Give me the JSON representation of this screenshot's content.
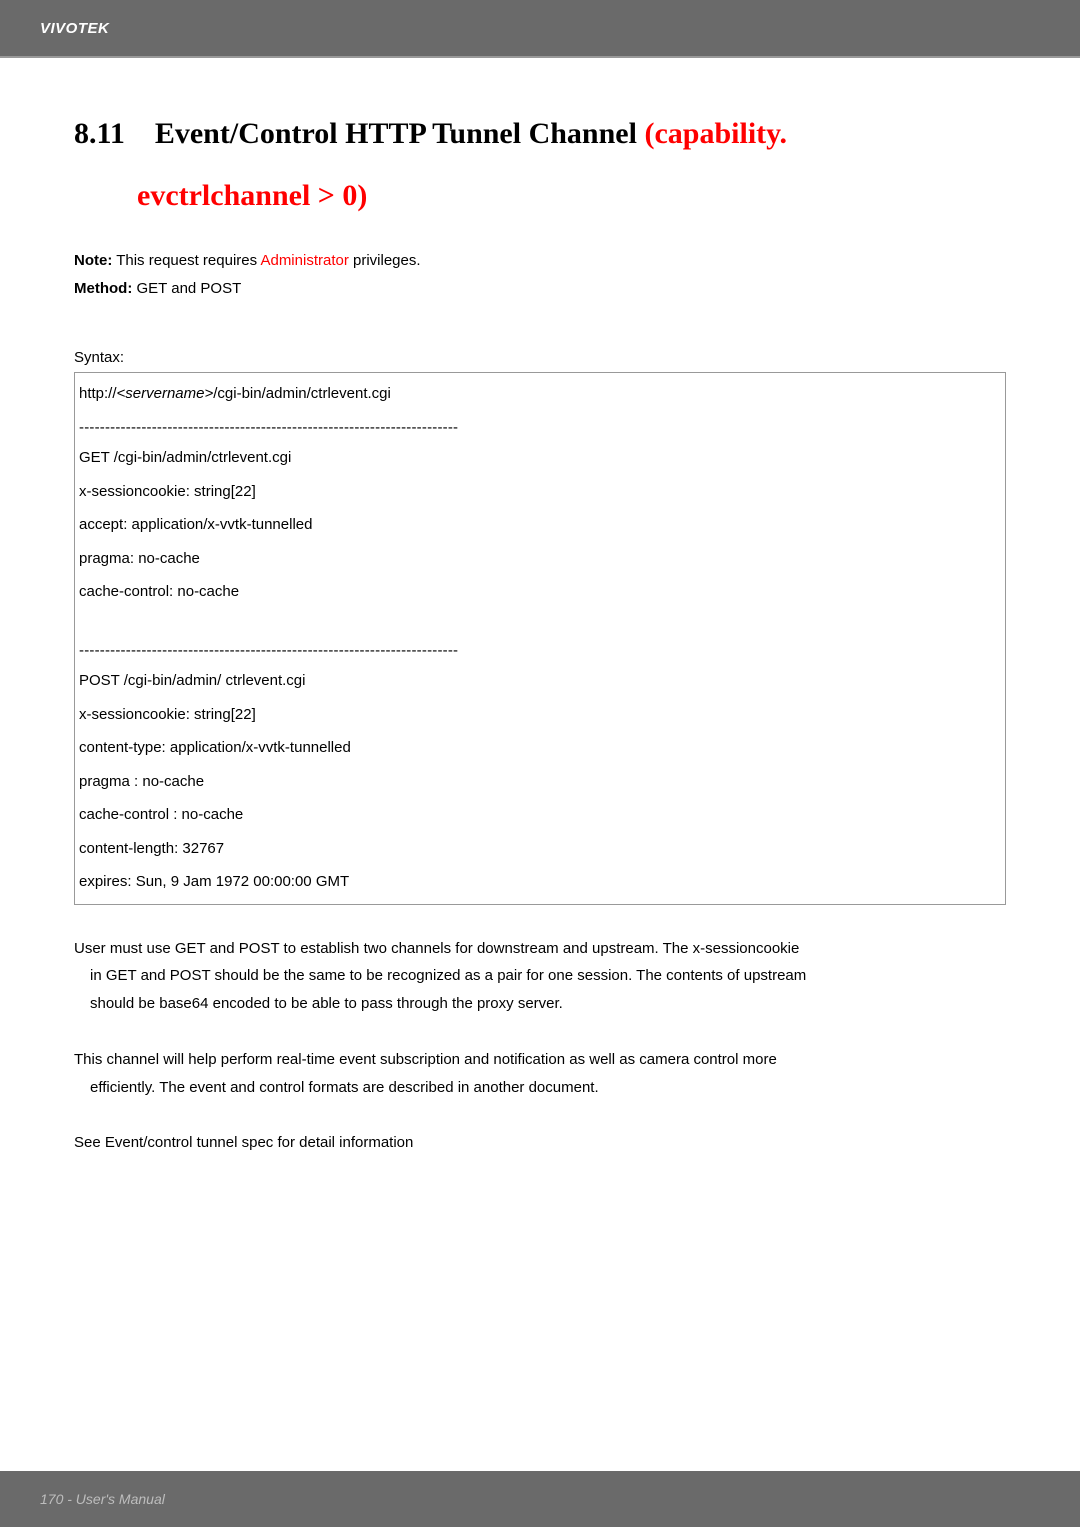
{
  "header": {
    "brand": "VIVOTEK"
  },
  "title": {
    "number": "8.11",
    "main_black": "Event/Control HTTP Tunnel Channel ",
    "main_red": "(capability.",
    "indent_red": "evctrlchannel > 0)"
  },
  "note": {
    "label": "Note:",
    "text_before": " This request requires ",
    "admin": "Administrator",
    "text_after": " privileges."
  },
  "method": {
    "label": "Method:",
    "value": " GET and POST"
  },
  "syntax_label": "Syntax:",
  "syntax": {
    "url_prefix": "http://",
    "servername": "<servername>",
    "url_suffix": "/cgi-bin/admin/ctrlevent.cgi",
    "dashes1": "-------------------------------------------------------------------------",
    "get": "GET /cgi-bin/admin/ctrlevent.cgi",
    "g1": "x-sessioncookie: string[22]",
    "g2": "accept: application/x-vvtk-tunnelled",
    "g3": "pragma: no-cache",
    "g4": "cache-control: no-cache",
    "dashes2": "-------------------------------------------------------------------------",
    "post": "POST /cgi-bin/admin/ ctrlevent.cgi",
    "p1": "x-sessioncookie: string[22]",
    "p2": "content-type: application/x-vvtk-tunnelled",
    "p3": "pragma : no-cache",
    "p4": "cache-control : no-cache",
    "p5": "content-length: 32767",
    "p6": "expires: Sun, 9 Jam 1972 00:00:00 GMT"
  },
  "paragraphs": {
    "p1a": "User must use GET and POST to establish two channels for downstream and upstream. The x-sessioncookie",
    "p1b": "in GET and POST should be the same to be recognized as a pair for one session. The contents of upstream",
    "p1c": "should be base64 encoded to be able to pass through the proxy server.",
    "p2a": "This channel will help perform real-time event subscription and notification as well as camera control more",
    "p2b": "efficiently. The event and control formats are described in another document.",
    "p3": "See Event/control tunnel spec for detail information"
  },
  "footer": {
    "text": "170 - User's Manual"
  }
}
